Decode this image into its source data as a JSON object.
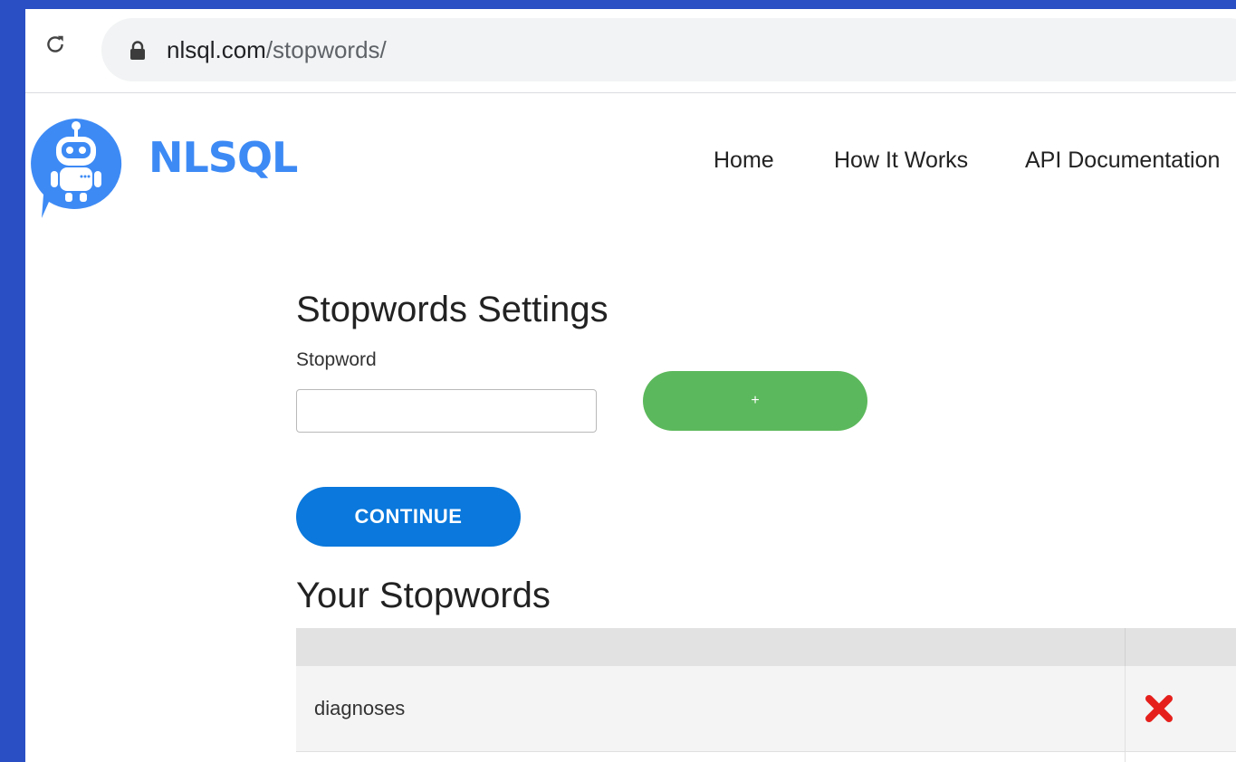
{
  "browser": {
    "url_host": "nlsql.com",
    "url_path": "/stopwords/"
  },
  "site": {
    "brand": "NLSQL",
    "nav": [
      "Home",
      "How It Works",
      "API Documentation"
    ]
  },
  "form": {
    "heading": "Stopwords Settings",
    "field_label": "Stopword",
    "input_value": "",
    "add_label": "+",
    "continue_label": "CONTINUE"
  },
  "stopwords": {
    "heading": "Your Stopwords",
    "items": [
      "diagnoses"
    ]
  },
  "colors": {
    "brand": "#3d8af5",
    "add_button": "#5cb85c",
    "continue_button": "#0a78dc",
    "delete_icon": "#e5201c"
  }
}
